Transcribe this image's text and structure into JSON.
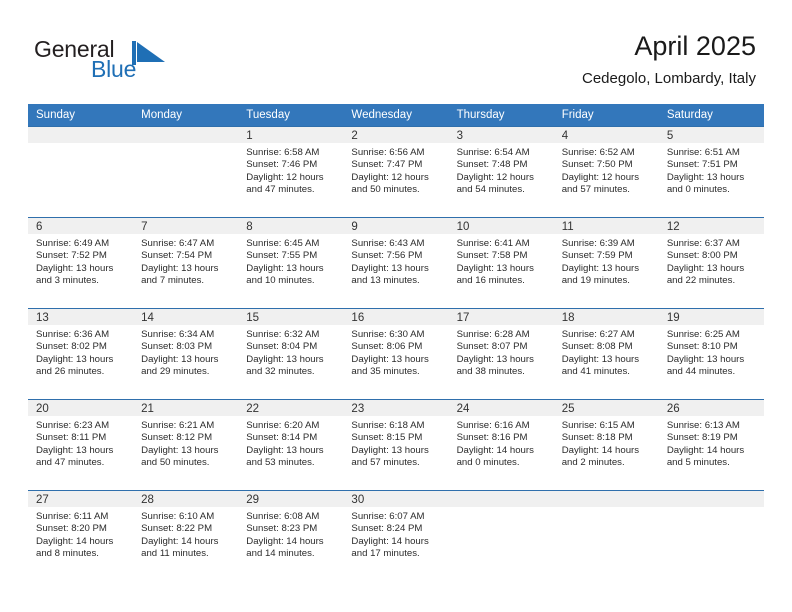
{
  "brand": {
    "name_part1": "General",
    "name_part2": "Blue",
    "mark_icon": "blue-triangle-flag-icon",
    "accent_color": "#1f6fb5"
  },
  "header": {
    "title": "April 2025",
    "subtitle": "Cedegolo, Lombardy, Italy"
  },
  "theme": {
    "header_row_bg": "#3377bb",
    "row_separator": "#2f6fac",
    "daynum_band_bg": "#f0f0f0",
    "text_color": "#2b2b2b"
  },
  "weekdays": [
    "Sunday",
    "Monday",
    "Tuesday",
    "Wednesday",
    "Thursday",
    "Friday",
    "Saturday"
  ],
  "weeks": [
    [
      {
        "day": ""
      },
      {
        "day": ""
      },
      {
        "day": "1",
        "sunrise": "Sunrise: 6:58 AM",
        "sunset": "Sunset: 7:46 PM",
        "daylight_1": "Daylight: 12 hours",
        "daylight_2": "and 47 minutes."
      },
      {
        "day": "2",
        "sunrise": "Sunrise: 6:56 AM",
        "sunset": "Sunset: 7:47 PM",
        "daylight_1": "Daylight: 12 hours",
        "daylight_2": "and 50 minutes."
      },
      {
        "day": "3",
        "sunrise": "Sunrise: 6:54 AM",
        "sunset": "Sunset: 7:48 PM",
        "daylight_1": "Daylight: 12 hours",
        "daylight_2": "and 54 minutes."
      },
      {
        "day": "4",
        "sunrise": "Sunrise: 6:52 AM",
        "sunset": "Sunset: 7:50 PM",
        "daylight_1": "Daylight: 12 hours",
        "daylight_2": "and 57 minutes."
      },
      {
        "day": "5",
        "sunrise": "Sunrise: 6:51 AM",
        "sunset": "Sunset: 7:51 PM",
        "daylight_1": "Daylight: 13 hours",
        "daylight_2": "and 0 minutes."
      }
    ],
    [
      {
        "day": "6",
        "sunrise": "Sunrise: 6:49 AM",
        "sunset": "Sunset: 7:52 PM",
        "daylight_1": "Daylight: 13 hours",
        "daylight_2": "and 3 minutes."
      },
      {
        "day": "7",
        "sunrise": "Sunrise: 6:47 AM",
        "sunset": "Sunset: 7:54 PM",
        "daylight_1": "Daylight: 13 hours",
        "daylight_2": "and 7 minutes."
      },
      {
        "day": "8",
        "sunrise": "Sunrise: 6:45 AM",
        "sunset": "Sunset: 7:55 PM",
        "daylight_1": "Daylight: 13 hours",
        "daylight_2": "and 10 minutes."
      },
      {
        "day": "9",
        "sunrise": "Sunrise: 6:43 AM",
        "sunset": "Sunset: 7:56 PM",
        "daylight_1": "Daylight: 13 hours",
        "daylight_2": "and 13 minutes."
      },
      {
        "day": "10",
        "sunrise": "Sunrise: 6:41 AM",
        "sunset": "Sunset: 7:58 PM",
        "daylight_1": "Daylight: 13 hours",
        "daylight_2": "and 16 minutes."
      },
      {
        "day": "11",
        "sunrise": "Sunrise: 6:39 AM",
        "sunset": "Sunset: 7:59 PM",
        "daylight_1": "Daylight: 13 hours",
        "daylight_2": "and 19 minutes."
      },
      {
        "day": "12",
        "sunrise": "Sunrise: 6:37 AM",
        "sunset": "Sunset: 8:00 PM",
        "daylight_1": "Daylight: 13 hours",
        "daylight_2": "and 22 minutes."
      }
    ],
    [
      {
        "day": "13",
        "sunrise": "Sunrise: 6:36 AM",
        "sunset": "Sunset: 8:02 PM",
        "daylight_1": "Daylight: 13 hours",
        "daylight_2": "and 26 minutes."
      },
      {
        "day": "14",
        "sunrise": "Sunrise: 6:34 AM",
        "sunset": "Sunset: 8:03 PM",
        "daylight_1": "Daylight: 13 hours",
        "daylight_2": "and 29 minutes."
      },
      {
        "day": "15",
        "sunrise": "Sunrise: 6:32 AM",
        "sunset": "Sunset: 8:04 PM",
        "daylight_1": "Daylight: 13 hours",
        "daylight_2": "and 32 minutes."
      },
      {
        "day": "16",
        "sunrise": "Sunrise: 6:30 AM",
        "sunset": "Sunset: 8:06 PM",
        "daylight_1": "Daylight: 13 hours",
        "daylight_2": "and 35 minutes."
      },
      {
        "day": "17",
        "sunrise": "Sunrise: 6:28 AM",
        "sunset": "Sunset: 8:07 PM",
        "daylight_1": "Daylight: 13 hours",
        "daylight_2": "and 38 minutes."
      },
      {
        "day": "18",
        "sunrise": "Sunrise: 6:27 AM",
        "sunset": "Sunset: 8:08 PM",
        "daylight_1": "Daylight: 13 hours",
        "daylight_2": "and 41 minutes."
      },
      {
        "day": "19",
        "sunrise": "Sunrise: 6:25 AM",
        "sunset": "Sunset: 8:10 PM",
        "daylight_1": "Daylight: 13 hours",
        "daylight_2": "and 44 minutes."
      }
    ],
    [
      {
        "day": "20",
        "sunrise": "Sunrise: 6:23 AM",
        "sunset": "Sunset: 8:11 PM",
        "daylight_1": "Daylight: 13 hours",
        "daylight_2": "and 47 minutes."
      },
      {
        "day": "21",
        "sunrise": "Sunrise: 6:21 AM",
        "sunset": "Sunset: 8:12 PM",
        "daylight_1": "Daylight: 13 hours",
        "daylight_2": "and 50 minutes."
      },
      {
        "day": "22",
        "sunrise": "Sunrise: 6:20 AM",
        "sunset": "Sunset: 8:14 PM",
        "daylight_1": "Daylight: 13 hours",
        "daylight_2": "and 53 minutes."
      },
      {
        "day": "23",
        "sunrise": "Sunrise: 6:18 AM",
        "sunset": "Sunset: 8:15 PM",
        "daylight_1": "Daylight: 13 hours",
        "daylight_2": "and 57 minutes."
      },
      {
        "day": "24",
        "sunrise": "Sunrise: 6:16 AM",
        "sunset": "Sunset: 8:16 PM",
        "daylight_1": "Daylight: 14 hours",
        "daylight_2": "and 0 minutes."
      },
      {
        "day": "25",
        "sunrise": "Sunrise: 6:15 AM",
        "sunset": "Sunset: 8:18 PM",
        "daylight_1": "Daylight: 14 hours",
        "daylight_2": "and 2 minutes."
      },
      {
        "day": "26",
        "sunrise": "Sunrise: 6:13 AM",
        "sunset": "Sunset: 8:19 PM",
        "daylight_1": "Daylight: 14 hours",
        "daylight_2": "and 5 minutes."
      }
    ],
    [
      {
        "day": "27",
        "sunrise": "Sunrise: 6:11 AM",
        "sunset": "Sunset: 8:20 PM",
        "daylight_1": "Daylight: 14 hours",
        "daylight_2": "and 8 minutes."
      },
      {
        "day": "28",
        "sunrise": "Sunrise: 6:10 AM",
        "sunset": "Sunset: 8:22 PM",
        "daylight_1": "Daylight: 14 hours",
        "daylight_2": "and 11 minutes."
      },
      {
        "day": "29",
        "sunrise": "Sunrise: 6:08 AM",
        "sunset": "Sunset: 8:23 PM",
        "daylight_1": "Daylight: 14 hours",
        "daylight_2": "and 14 minutes."
      },
      {
        "day": "30",
        "sunrise": "Sunrise: 6:07 AM",
        "sunset": "Sunset: 8:24 PM",
        "daylight_1": "Daylight: 14 hours",
        "daylight_2": "and 17 minutes."
      },
      {
        "day": ""
      },
      {
        "day": ""
      },
      {
        "day": ""
      }
    ]
  ]
}
